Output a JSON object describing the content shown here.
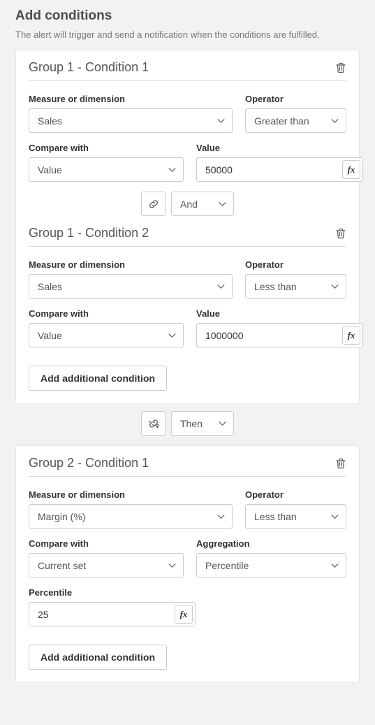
{
  "page": {
    "title": "Add conditions",
    "subtitle": "The alert will trigger and send a notification when the conditions are fulfilled."
  },
  "labels": {
    "measure": "Measure or dimension",
    "operator": "Operator",
    "compare": "Compare with",
    "value": "Value",
    "aggregation": "Aggregation",
    "percentile": "Percentile",
    "add": "Add additional condition"
  },
  "groups": [
    {
      "conditions": [
        {
          "title": "Group 1 - Condition 1",
          "measure": "Sales",
          "operator": "Greater than",
          "compare": "Value",
          "value": "50000"
        },
        {
          "title": "Group 1 - Condition 2",
          "measure": "Sales",
          "operator": "Less than",
          "compare": "Value",
          "value": "1000000"
        }
      ],
      "connector": "And"
    },
    {
      "conditions": [
        {
          "title": "Group 2 - Condition 1",
          "measure": "Margin (%)",
          "operator": "Less than",
          "compare": "Current set",
          "aggregation": "Percentile",
          "percentile": "25"
        }
      ]
    }
  ],
  "group_connector": "Then"
}
